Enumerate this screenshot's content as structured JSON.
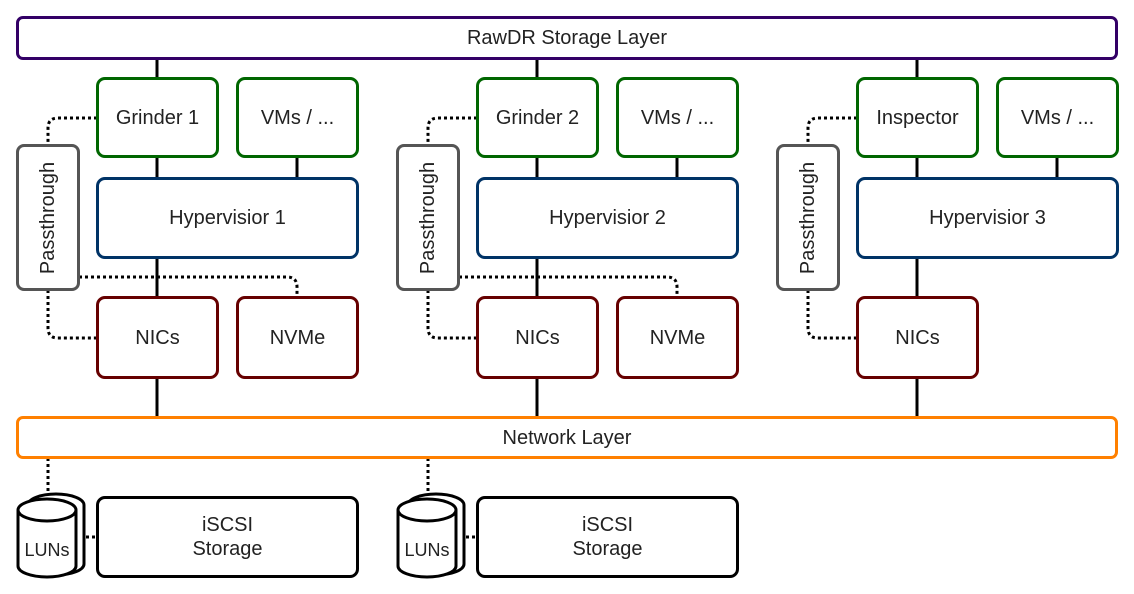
{
  "layers": {
    "storage": "RawDR Storage Layer",
    "network": "Network Layer"
  },
  "columns": [
    {
      "vm": "Grinder 1",
      "other_vms": "VMs / ...",
      "hypervisor": "Hypervisior 1",
      "passthrough": "Passthrough",
      "nics": "NICs",
      "nvme": "NVMe",
      "has_nvme": true
    },
    {
      "vm": "Grinder 2",
      "other_vms": "VMs / ...",
      "hypervisor": "Hypervisior 2",
      "passthrough": "Passthrough",
      "nics": "NICs",
      "nvme": "NVMe",
      "has_nvme": true
    },
    {
      "vm": "Inspector",
      "other_vms": "VMs / ...",
      "hypervisor": "Hypervisior 3",
      "passthrough": "Passthrough",
      "nics": "NICs",
      "has_nvme": false
    }
  ],
  "storage_targets": [
    {
      "luns": "LUNs",
      "iscsi_line1": "iSCSI",
      "iscsi_line2": "Storage"
    },
    {
      "luns": "LUNs",
      "iscsi_line1": "iSCSI",
      "iscsi_line2": "Storage"
    }
  ],
  "colors": {
    "storage_layer": "#330066",
    "network_layer": "#ff8000",
    "vm": "#006600",
    "hypervisor": "#003366",
    "hardware": "#660000",
    "passthrough": "#555555"
  }
}
